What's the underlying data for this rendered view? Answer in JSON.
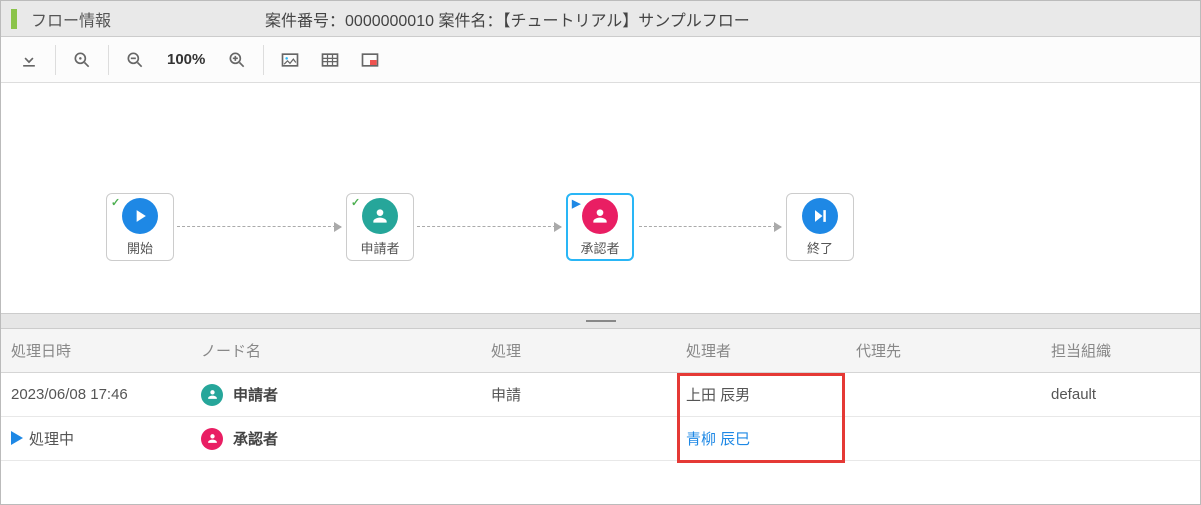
{
  "header": {
    "title": "フロー情報",
    "subtitle": "案件番号：0000000010 案件名：【チュートリアル】サンプルフロー"
  },
  "toolbar": {
    "zoom_level": "100%"
  },
  "flow": {
    "nodes": [
      {
        "label": "開始",
        "color": "blue",
        "badge": "check"
      },
      {
        "label": "申請者",
        "color": "teal",
        "badge": "check"
      },
      {
        "label": "承認者",
        "color": "magenta",
        "badge": "play",
        "active": true
      },
      {
        "label": "終了",
        "color": "blue",
        "badge": ""
      }
    ]
  },
  "table": {
    "columns": [
      "処理日時",
      "ノード名",
      "処理",
      "処理者",
      "代理先",
      "担当組織"
    ],
    "rows": [
      {
        "datetime": "2023/06/08 17:46",
        "node_name": "申請者",
        "node_color": "teal",
        "action": "申請",
        "operator": "上田 辰男",
        "operator_link": false,
        "proxy": "",
        "org": "default"
      },
      {
        "datetime_label": "処理中",
        "datetime_icon": "play",
        "node_name": "承認者",
        "node_color": "magenta",
        "action": "",
        "operator": "青柳 辰巳",
        "operator_link": true,
        "proxy": "",
        "org": ""
      }
    ]
  }
}
